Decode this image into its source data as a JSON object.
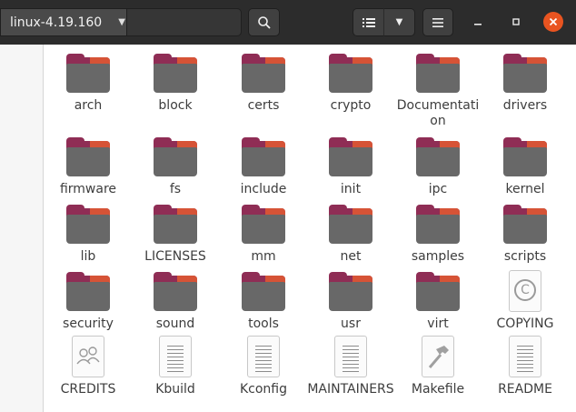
{
  "header": {
    "path_label": "linux-4.19.160",
    "icons": {
      "chevron": "chevron-down-icon",
      "search": "search-icon",
      "list_view": "list-view-icon",
      "menu": "hamburger-menu-icon",
      "minimize": "minimize-icon",
      "maximize": "maximize-icon",
      "close": "close-icon"
    },
    "accent_close": "#e95420",
    "bar_color": "#2c2c2c"
  },
  "files": [
    {
      "name": "arch",
      "type": "folder"
    },
    {
      "name": "block",
      "type": "folder"
    },
    {
      "name": "certs",
      "type": "folder"
    },
    {
      "name": "crypto",
      "type": "folder"
    },
    {
      "name": "Documentation",
      "type": "folder"
    },
    {
      "name": "drivers",
      "type": "folder"
    },
    {
      "name": "firmware",
      "type": "folder"
    },
    {
      "name": "fs",
      "type": "folder"
    },
    {
      "name": "include",
      "type": "folder"
    },
    {
      "name": "init",
      "type": "folder"
    },
    {
      "name": "ipc",
      "type": "folder"
    },
    {
      "name": "kernel",
      "type": "folder"
    },
    {
      "name": "lib",
      "type": "folder"
    },
    {
      "name": "LICENSES",
      "type": "folder"
    },
    {
      "name": "mm",
      "type": "folder"
    },
    {
      "name": "net",
      "type": "folder"
    },
    {
      "name": "samples",
      "type": "folder"
    },
    {
      "name": "scripts",
      "type": "folder"
    },
    {
      "name": "security",
      "type": "folder"
    },
    {
      "name": "sound",
      "type": "folder"
    },
    {
      "name": "tools",
      "type": "folder"
    },
    {
      "name": "usr",
      "type": "folder"
    },
    {
      "name": "virt",
      "type": "folder"
    },
    {
      "name": "COPYING",
      "type": "copyright-file"
    },
    {
      "name": "CREDITS",
      "type": "contacts-file"
    },
    {
      "name": "Kbuild",
      "type": "text-file"
    },
    {
      "name": "Kconfig",
      "type": "text-file"
    },
    {
      "name": "MAINTAINERS",
      "type": "text-file"
    },
    {
      "name": "Makefile",
      "type": "makefile"
    },
    {
      "name": "README",
      "type": "text-file"
    }
  ]
}
